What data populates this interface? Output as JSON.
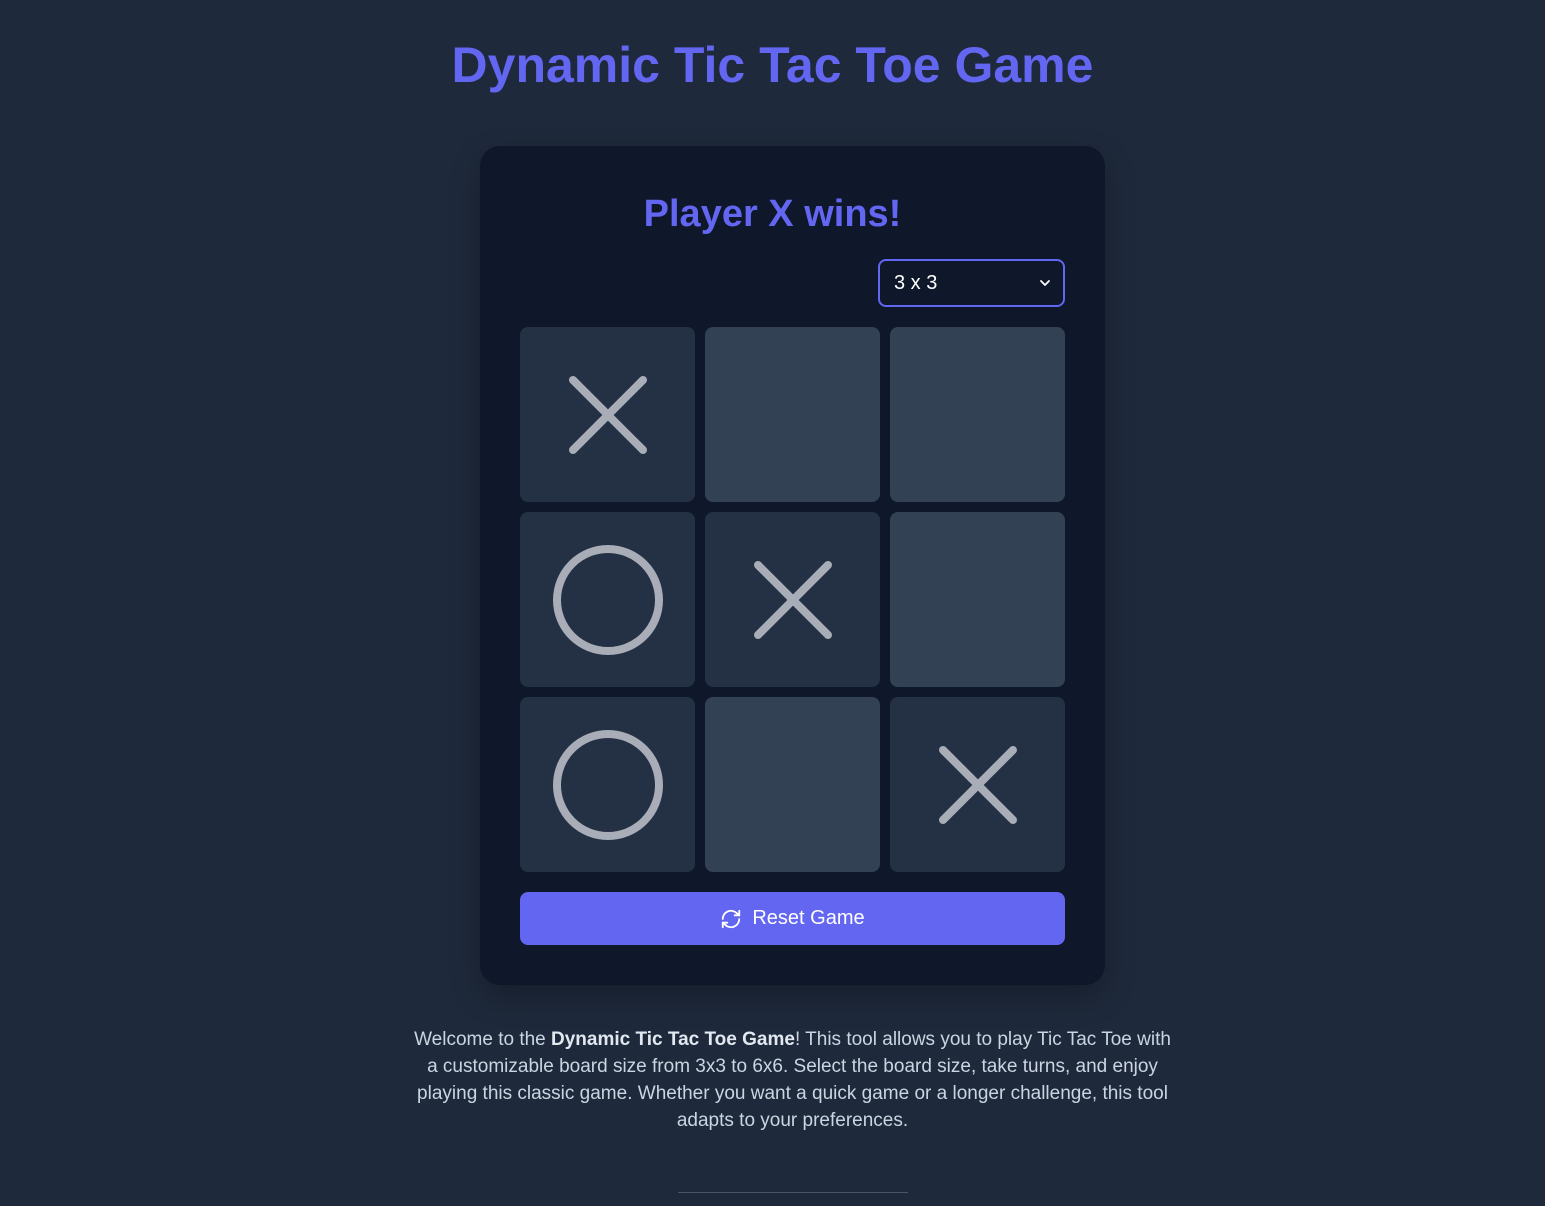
{
  "header": {
    "title": "Dynamic Tic Tac Toe Game"
  },
  "game": {
    "status": "Player X wins!",
    "board_size": {
      "selected": "3 x 3",
      "icon": "chevron-down-icon"
    },
    "board": [
      [
        "X",
        "",
        ""
      ],
      [
        "O",
        "X",
        ""
      ],
      [
        "O",
        "",
        "X"
      ]
    ],
    "reset": {
      "label": "Reset Game",
      "icon": "refresh-icon"
    }
  },
  "description": {
    "prefix": "Welcome to the ",
    "bold": "Dynamic Tic Tac Toe Game",
    "suffix": "! This tool allows you to play Tic Tac Toe with a customizable board size from 3x3 to 6x6. Select the board size, take turns, and enjoy playing this classic game. Whether you want a quick game or a longer challenge, this tool adapts to your preferences."
  },
  "colors": {
    "background": "#1e293b",
    "card": "#0f172a",
    "accent": "#6366f1",
    "cell_empty": "#334155",
    "cell_filled": "#243145",
    "mark": "#a8adb7"
  }
}
